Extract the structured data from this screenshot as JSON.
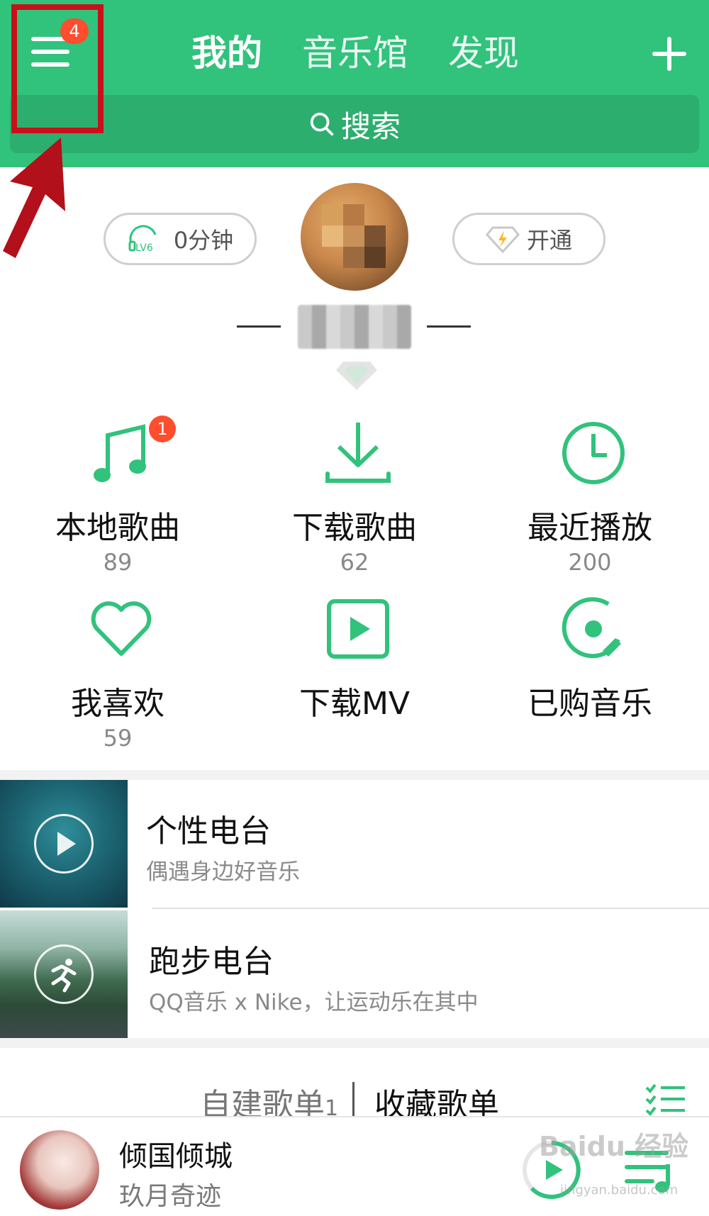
{
  "header": {
    "menu_badge": "4",
    "tabs": [
      {
        "label": "我的",
        "active": true
      },
      {
        "label": "音乐馆",
        "active": false
      },
      {
        "label": "发现",
        "active": false
      }
    ],
    "search_placeholder": "搜索",
    "accent_color": "#31c27c"
  },
  "profile": {
    "listen_level": "LV6",
    "listen_time": "0分钟",
    "vip_label": "开通"
  },
  "grid": [
    {
      "label": "本地歌曲",
      "count": "89",
      "badge": "1",
      "icon": "music-note-icon"
    },
    {
      "label": "下载歌曲",
      "count": "62",
      "icon": "download-icon"
    },
    {
      "label": "最近播放",
      "count": "200",
      "icon": "clock-icon"
    },
    {
      "label": "我喜欢",
      "count": "59",
      "icon": "heart-icon"
    },
    {
      "label": "下载MV",
      "count": "",
      "icon": "video-play-icon"
    },
    {
      "label": "已购音乐",
      "count": "",
      "icon": "disc-icon"
    }
  ],
  "radios": [
    {
      "title": "个性电台",
      "subtitle": "偶遇身边好音乐"
    },
    {
      "title": "跑步电台",
      "subtitle": "QQ音乐 x Nike，让运动乐在其中"
    }
  ],
  "playlists": {
    "created_label": "自建歌单",
    "created_count": "1",
    "favorite_label": "收藏歌单"
  },
  "player": {
    "title": "倾国倾城",
    "artist": "玖月奇迹"
  },
  "watermark": {
    "text": "Baidu 经验",
    "sub": "jingyan.baidu.com"
  }
}
